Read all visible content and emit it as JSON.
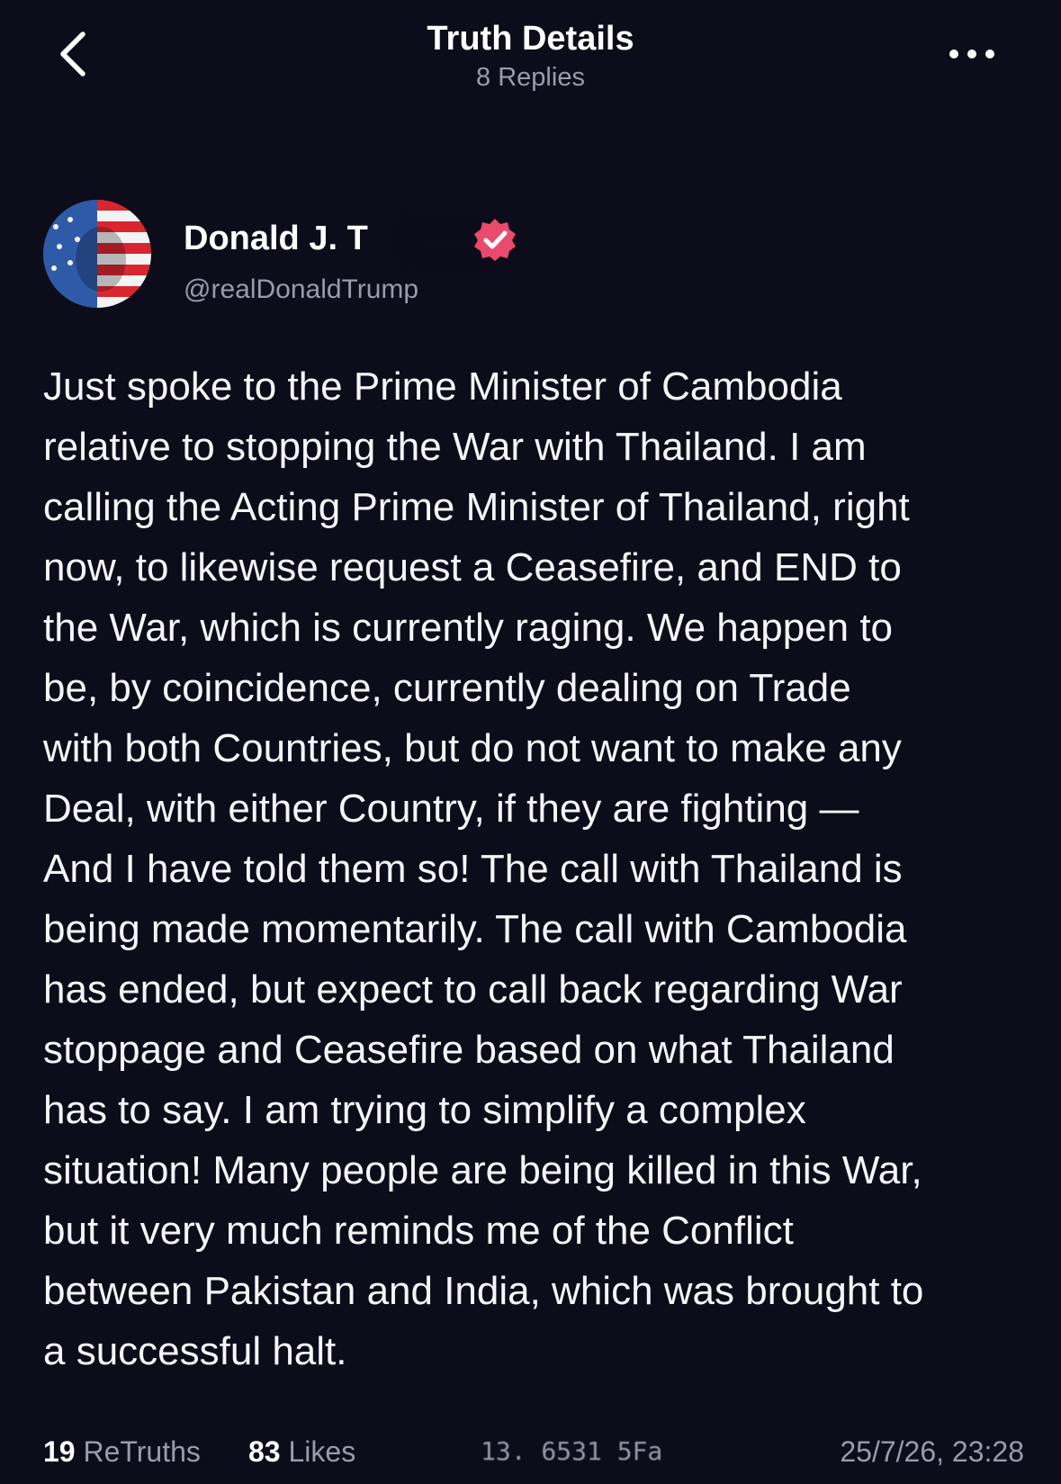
{
  "header": {
    "title": "Truth Details",
    "subtitle": "8 Replies"
  },
  "author": {
    "display_name": "Donald J. T",
    "handle": "@realDonaldTrump",
    "verified": true
  },
  "post": {
    "lines": [
      "Just spoke to the Prime Minister of Cambodia",
      "relative to stopping the War with Thailand. I am",
      "calling the Acting Prime Minister of Thailand, right",
      "now, to likewise request a Ceasefire, and END to",
      "the War, which is currently raging. We happen to",
      "be, by coincidence, currently dealing on Trade",
      "with both Countries, but do not want to make any",
      "Deal, with either Country, if they are fighting —",
      "And I have told them so! The call with Thailand is",
      "being made momentarily. The call with Cambodia",
      "has ended, but expect to call back regarding War",
      "stoppage and Ceasefire based on what Thailand",
      "has to say. I am trying to simplify a complex",
      "situation! Many people are being killed in this War,",
      "but it very much reminds me of the Conflict",
      "between Pakistan and India, which was brought to",
      "a successful halt."
    ]
  },
  "footer": {
    "retruths_count": "19",
    "retruths_label": "ReTruths",
    "likes_count": "83",
    "likes_label": "Likes",
    "garbled_text": "13. 6531 5Fa",
    "timestamp": "25/7/26, 23:28"
  },
  "colors": {
    "background": "#0d0c1a",
    "muted_text": "#9b9aad",
    "verified_badge": "#ea4a6b"
  },
  "icons": {
    "back": "chevron-left-icon",
    "more": "more-horizontal-icon",
    "verified": "verified-badge-icon"
  }
}
